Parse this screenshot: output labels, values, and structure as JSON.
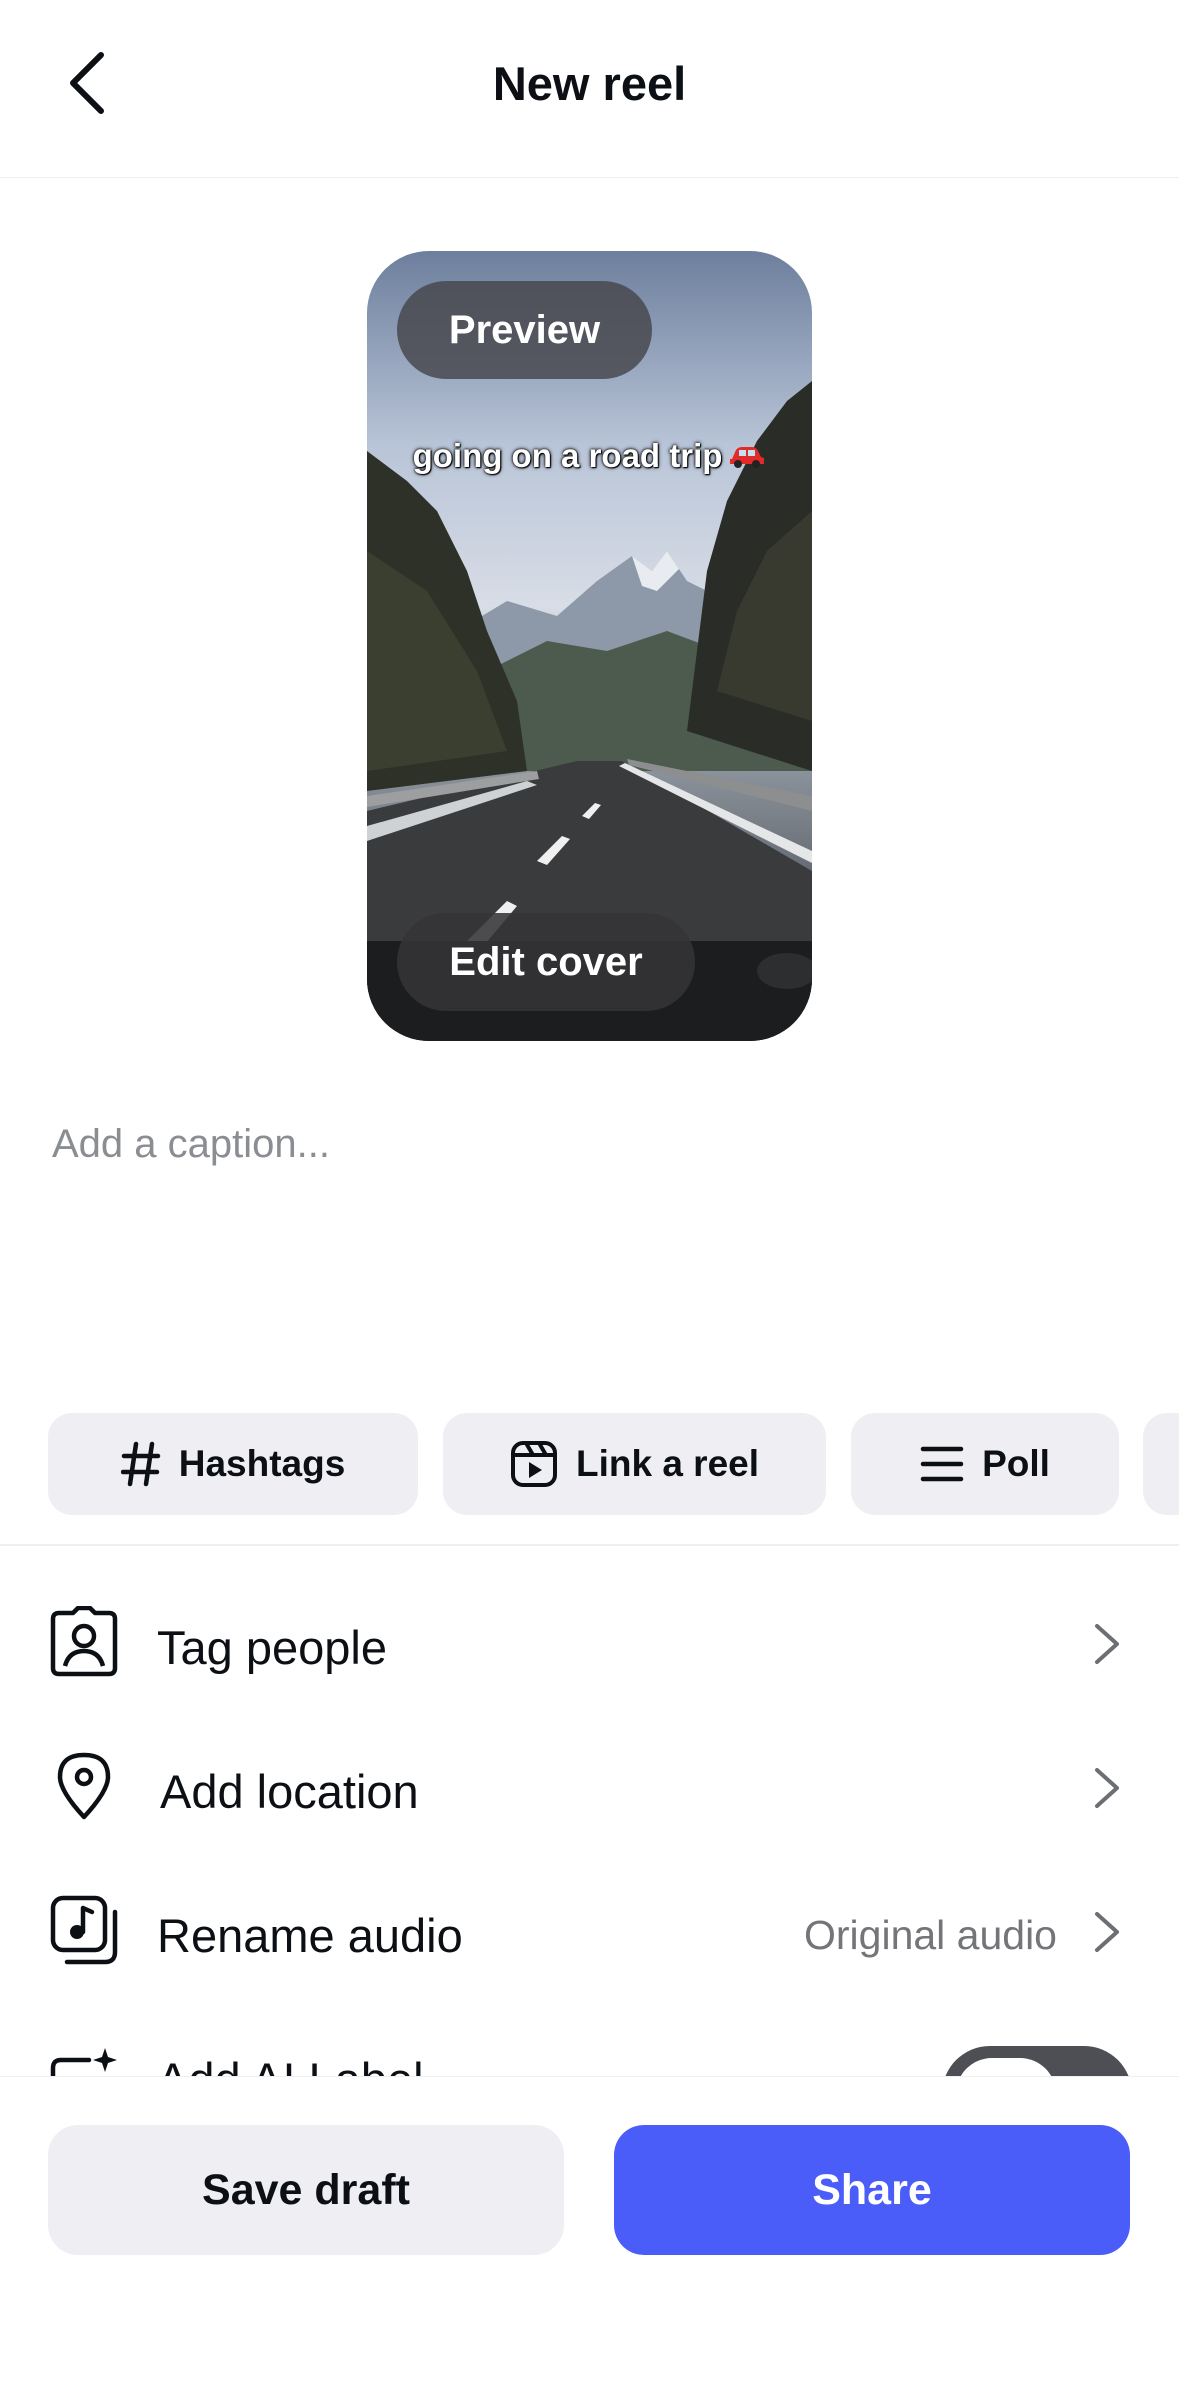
{
  "header": {
    "title": "New reel",
    "back_icon": "chevron-left-icon"
  },
  "reel": {
    "preview_label": "Preview",
    "overlay_text": "going on a road trip",
    "overlay_emoji_icon": "red-car-icon",
    "edit_cover_label": "Edit cover"
  },
  "caption": {
    "placeholder": "Add a caption..."
  },
  "chips": [
    {
      "label": "Hashtags",
      "icon": "hashtag-icon"
    },
    {
      "label": "Link a reel",
      "icon": "reel-icon"
    },
    {
      "label": "Poll",
      "icon": "list-icon"
    }
  ],
  "rows": [
    {
      "label": "Tag people",
      "icon": "tag-person-icon",
      "value": ""
    },
    {
      "label": "Add location",
      "icon": "location-pin-icon",
      "value": ""
    },
    {
      "label": "Rename audio",
      "icon": "music-note-icon",
      "value": "Original audio"
    },
    {
      "label": "Add AI Label",
      "icon": "ai-sparkle-icon",
      "toggle": true
    }
  ],
  "actions": {
    "save_draft": "Save draft",
    "share": "Share"
  },
  "colors": {
    "accent": "#4a5df9",
    "chip_bg": "#efeff3",
    "text_primary": "#0c1014",
    "text_secondary": "#737579"
  }
}
